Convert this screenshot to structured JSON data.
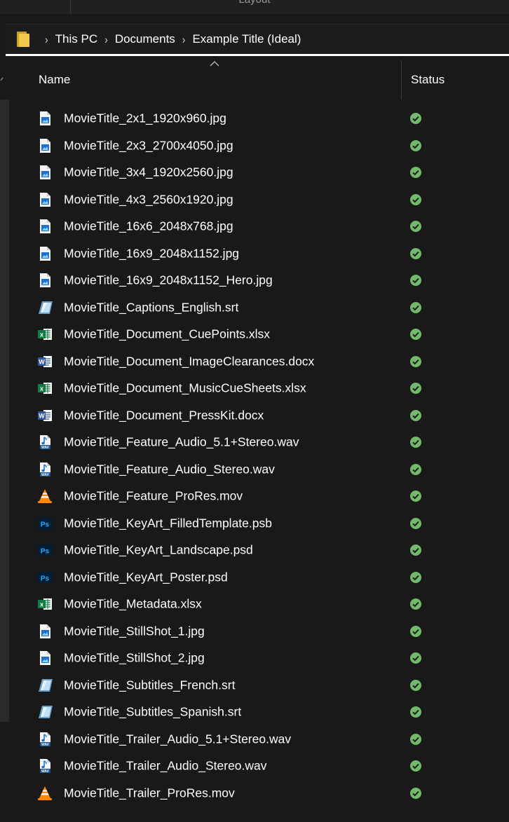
{
  "window": {
    "title_fragment": "Layout"
  },
  "address_bar": {
    "crumbs": [
      "This PC",
      "Documents",
      "Example Title (Ideal)"
    ]
  },
  "columns": {
    "name": "Name",
    "status": "Status"
  },
  "files": [
    {
      "name": "MovieTitle_2x1_1920x960.jpg",
      "icon": "image-file-icon",
      "status": "synced"
    },
    {
      "name": "MovieTitle_2x3_2700x4050.jpg",
      "icon": "image-file-icon",
      "status": "synced"
    },
    {
      "name": "MovieTitle_3x4_1920x2560.jpg",
      "icon": "image-file-icon",
      "status": "synced"
    },
    {
      "name": "MovieTitle_4x3_2560x1920.jpg",
      "icon": "image-file-icon",
      "status": "synced"
    },
    {
      "name": "MovieTitle_16x6_2048x768.jpg",
      "icon": "image-file-icon",
      "status": "synced"
    },
    {
      "name": "MovieTitle_16x9_2048x1152.jpg",
      "icon": "image-file-icon",
      "status": "synced"
    },
    {
      "name": "MovieTitle_16x9_2048x1152_Hero.jpg",
      "icon": "image-file-icon",
      "status": "synced"
    },
    {
      "name": "MovieTitle_Captions_English.srt",
      "icon": "subtitle-file-icon",
      "status": "synced"
    },
    {
      "name": "MovieTitle_Document_CuePoints.xlsx",
      "icon": "excel-file-icon",
      "status": "synced"
    },
    {
      "name": "MovieTitle_Document_ImageClearances.docx",
      "icon": "word-file-icon",
      "status": "synced"
    },
    {
      "name": "MovieTitle_Document_MusicCueSheets.xlsx",
      "icon": "excel-file-icon",
      "status": "synced"
    },
    {
      "name": "MovieTitle_Document_PressKit.docx",
      "icon": "word-file-icon",
      "status": "synced"
    },
    {
      "name": "MovieTitle_Feature_Audio_5.1+Stereo.wav",
      "icon": "audio-file-icon",
      "status": "synced"
    },
    {
      "name": "MovieTitle_Feature_Audio_Stereo.wav",
      "icon": "audio-file-icon",
      "status": "synced"
    },
    {
      "name": "MovieTitle_Feature_ProRes.mov",
      "icon": "vlc-video-file-icon",
      "status": "synced"
    },
    {
      "name": "MovieTitle_KeyArt_FilledTemplate.psb",
      "icon": "photoshop-file-icon",
      "status": "synced"
    },
    {
      "name": "MovieTitle_KeyArt_Landscape.psd",
      "icon": "photoshop-file-icon",
      "status": "synced"
    },
    {
      "name": "MovieTitle_KeyArt_Poster.psd",
      "icon": "photoshop-file-icon",
      "status": "synced"
    },
    {
      "name": "MovieTitle_Metadata.xlsx",
      "icon": "excel-file-icon",
      "status": "synced"
    },
    {
      "name": "MovieTitle_StillShot_1.jpg",
      "icon": "image-file-icon",
      "status": "synced"
    },
    {
      "name": "MovieTitle_StillShot_2.jpg",
      "icon": "image-file-icon",
      "status": "synced"
    },
    {
      "name": "MovieTitle_Subtitles_French.srt",
      "icon": "subtitle-file-icon",
      "status": "synced"
    },
    {
      "name": "MovieTitle_Subtitles_Spanish.srt",
      "icon": "subtitle-file-icon",
      "status": "synced"
    },
    {
      "name": "MovieTitle_Trailer_Audio_5.1+Stereo.wav",
      "icon": "audio-file-icon",
      "status": "synced"
    },
    {
      "name": "MovieTitle_Trailer_Audio_Stereo.wav",
      "icon": "audio-file-icon",
      "status": "synced"
    },
    {
      "name": "MovieTitle_Trailer_ProRes.mov",
      "icon": "vlc-video-file-icon",
      "status": "synced"
    }
  ],
  "colors": {
    "background": "#191919",
    "status_ok": "#73b96b",
    "folder": "#f2c94c"
  }
}
